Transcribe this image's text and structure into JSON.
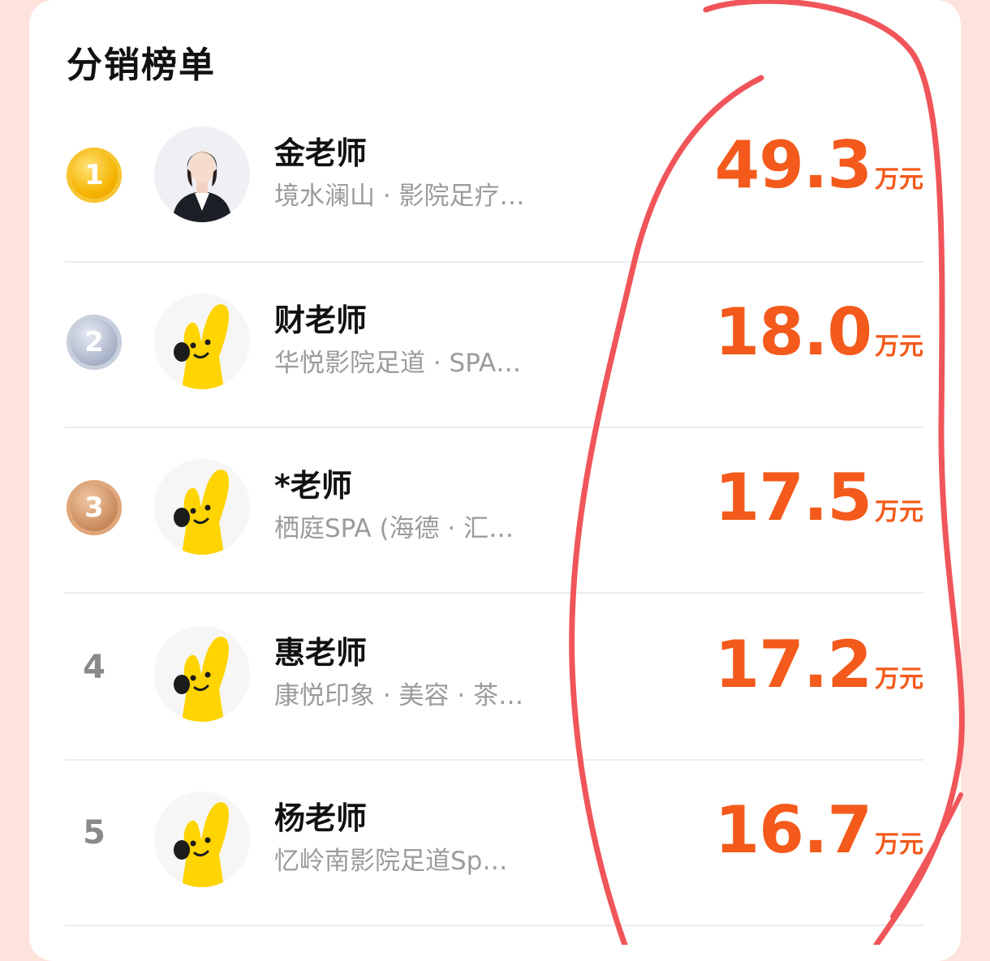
{
  "board": {
    "title": "分销榜单",
    "unit": "万元",
    "rows": [
      {
        "rank": "1",
        "name": "金老师",
        "sub": "境水澜山 · 影院足疗…",
        "amount": "49.3",
        "avatar": "person-photo"
      },
      {
        "rank": "2",
        "name": "财老师",
        "sub": "华悦影院足道 · SPA…",
        "amount": "18.0",
        "avatar": "yellow-hand-mascot"
      },
      {
        "rank": "3",
        "name": "*老师",
        "sub": "栖庭SPA (海德 · 汇…",
        "amount": "17.5",
        "avatar": "yellow-hand-mascot"
      },
      {
        "rank": "4",
        "name": "惠老师",
        "sub": "康悦印象 · 美容 · 茶…",
        "amount": "17.2",
        "avatar": "yellow-hand-mascot"
      },
      {
        "rank": "5",
        "name": "杨老师",
        "sub": "忆岭南影院足道Sp…",
        "amount": "16.7",
        "avatar": "yellow-hand-mascot"
      }
    ]
  },
  "colors": {
    "page_background": "#fde3dc",
    "amount": "#f35a1b",
    "annotation_stroke": "#f0555a"
  }
}
